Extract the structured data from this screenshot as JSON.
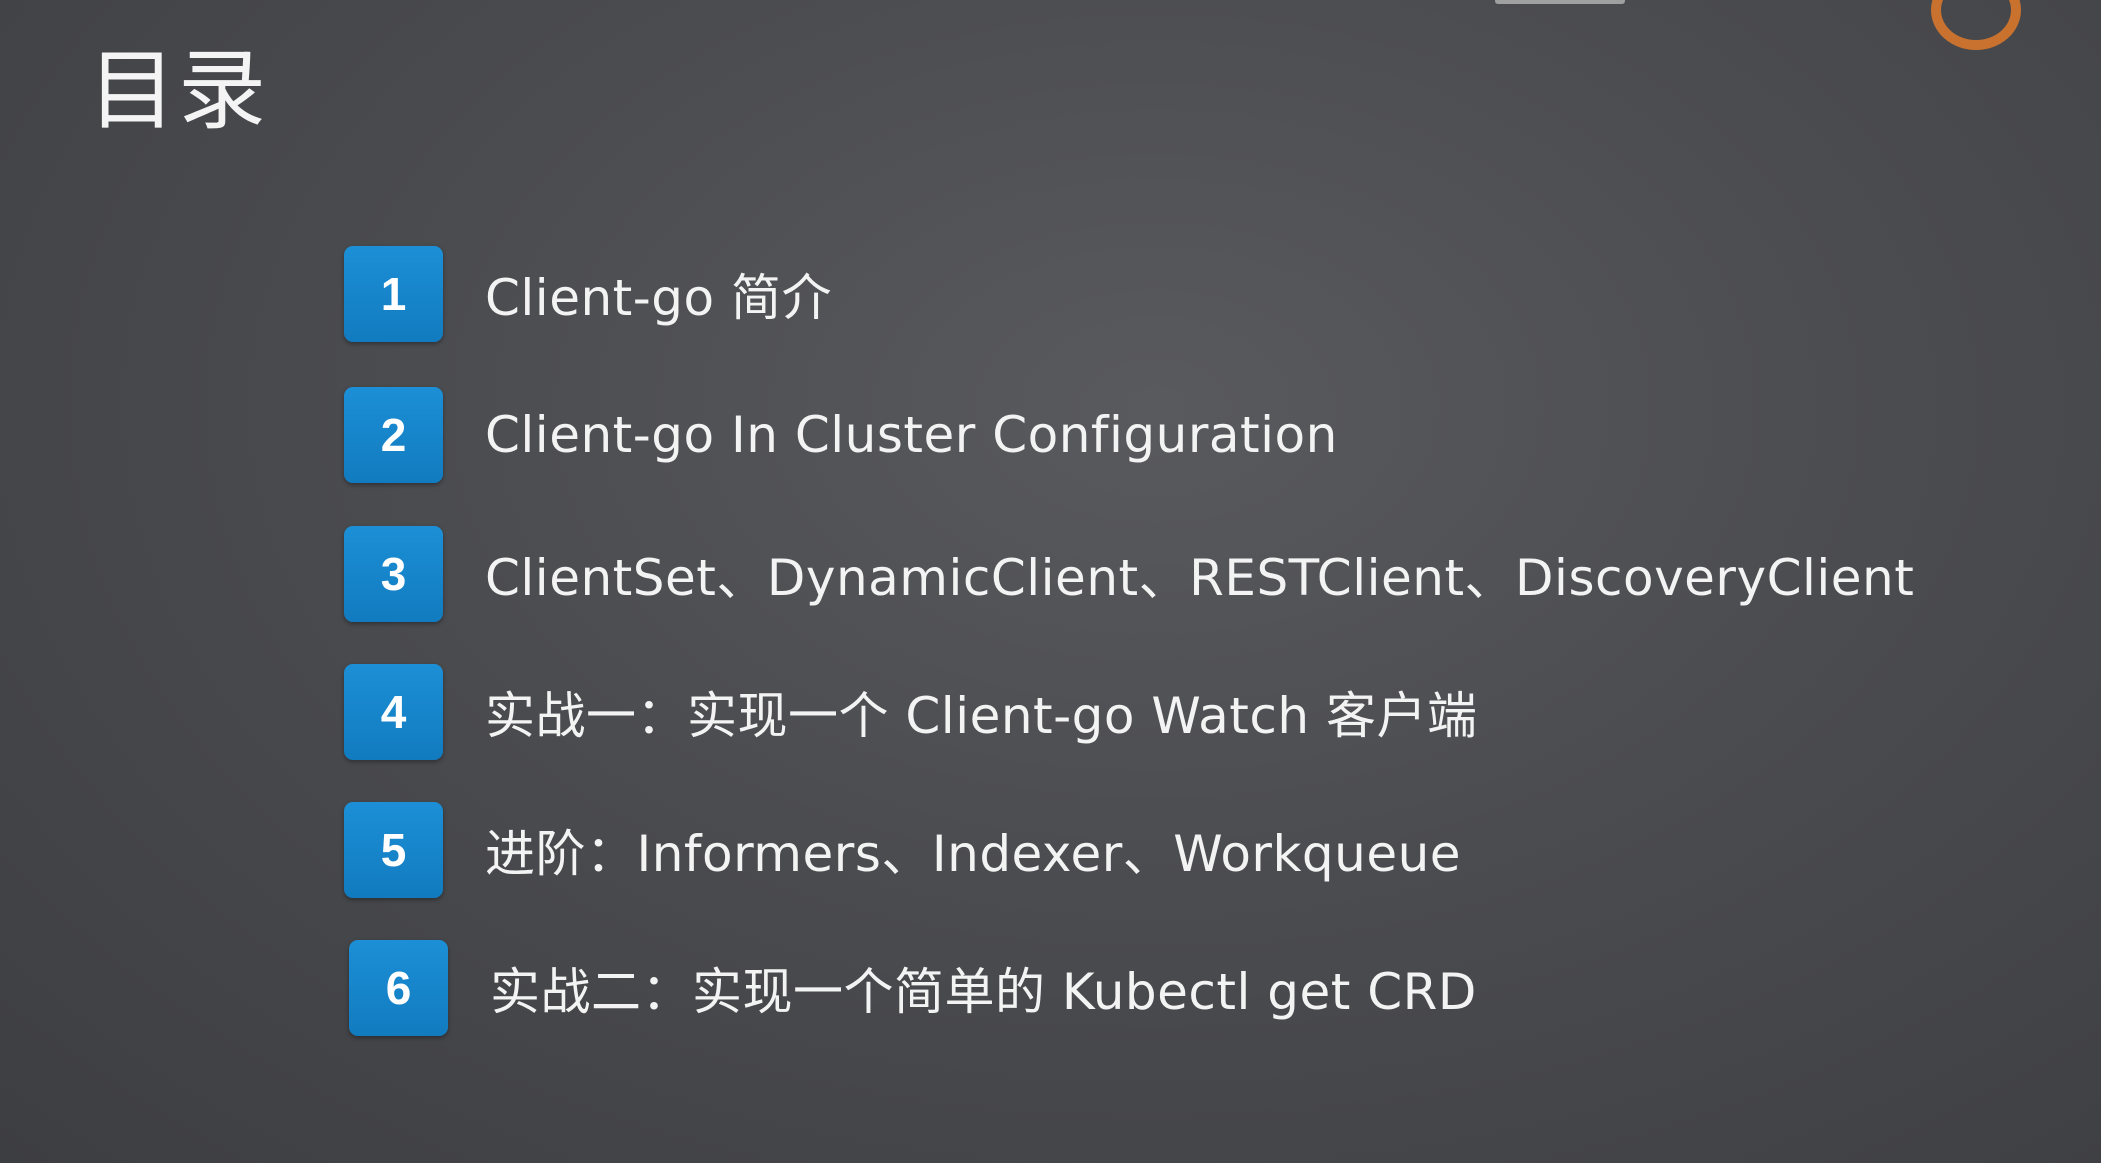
{
  "slide": {
    "title": "目录",
    "items": [
      {
        "number": "1",
        "text": "Client-go 简介"
      },
      {
        "number": "2",
        "text": "Client-go In Cluster Configuration"
      },
      {
        "number": "3",
        "text": "ClientSet、DynamicClient、RESTClient、DiscoveryClient"
      },
      {
        "number": "4",
        "text": "实战一：实现一个 Client-go Watch 客户端"
      },
      {
        "number": "5",
        "text": "进阶：Informers、Indexer、Workqueue"
      },
      {
        "number": "6",
        "text": "实战二：实现一个简单的 Kubectl get CRD"
      }
    ]
  },
  "colors": {
    "background": "#4b4c50",
    "badge": "#1b8ad0",
    "text": "#f3f3f3",
    "logo": "#e07a2a"
  },
  "icons": {
    "logo": "brand-logo-icon"
  }
}
